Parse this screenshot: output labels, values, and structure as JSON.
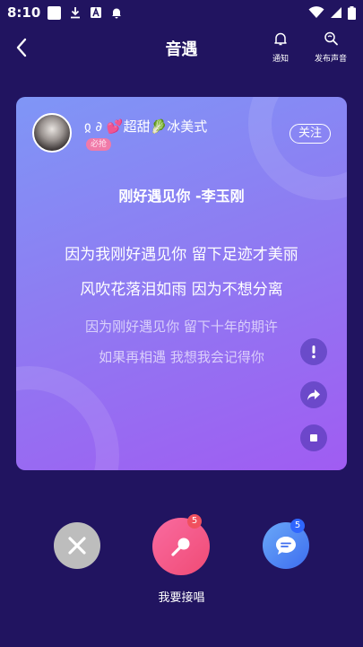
{
  "status_bar": {
    "time": "8:10"
  },
  "header": {
    "title": "音遇",
    "notify_label": "通知",
    "publish_label": "发布声音"
  },
  "card": {
    "username": "ჲ ∂ 💕超甜🥬冰美式",
    "badge": "必抢",
    "follow_label": "关注",
    "song_title": "刚好遇见你 -李玉刚",
    "lyrics": [
      "因为我刚好遇见你 留下足迹才美丽",
      "风吹花落泪如雨 因为不想分离",
      "因为刚好遇见你 留下十年的期许",
      "如果再相遇 我想我会记得你"
    ]
  },
  "bottom": {
    "sing_count": "5",
    "comment_count": "5",
    "sing_label": "我要接唱"
  },
  "colors": {
    "background": "#211460",
    "card_gradient_start": "#7f96f6",
    "card_gradient_end": "#a05cf2",
    "sing_button": "#f04b75",
    "comment_button": "#3d6df0"
  }
}
